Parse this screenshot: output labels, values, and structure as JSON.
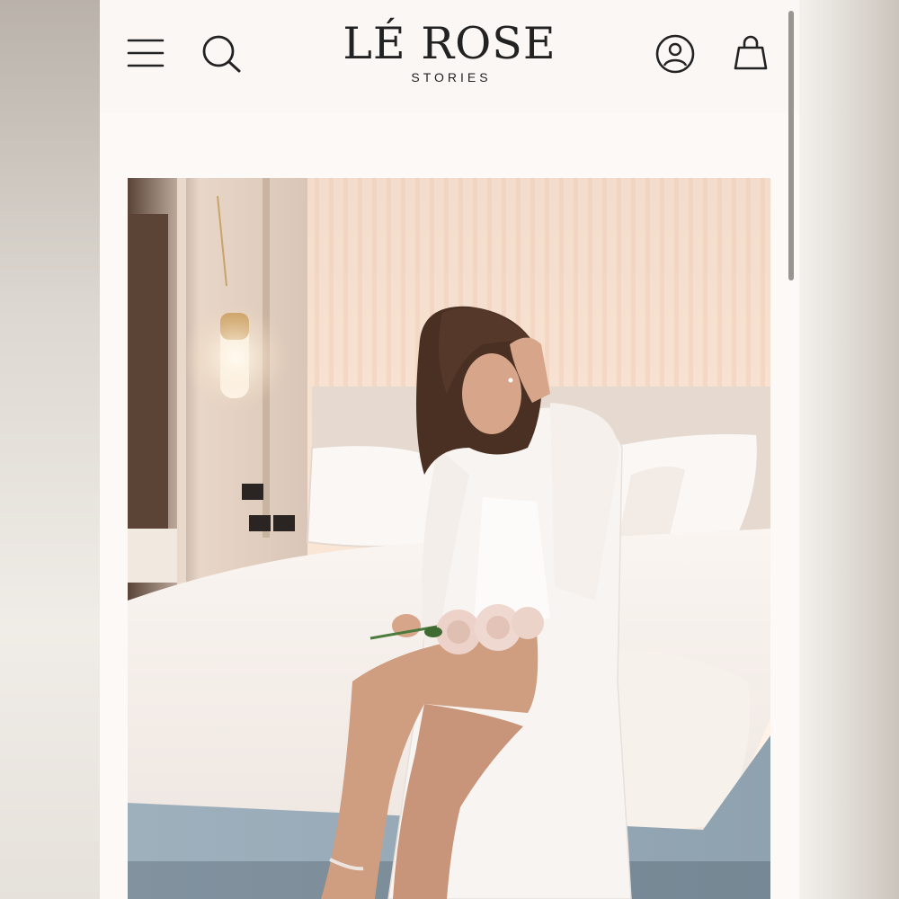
{
  "header": {
    "brand_name": "LÉ ROSE",
    "brand_tagline": "STORIES",
    "icons": {
      "menu": "hamburger-menu-icon",
      "search": "search-icon",
      "account": "user-account-icon",
      "cart": "shopping-bag-icon"
    }
  },
  "hero": {
    "image": "woman-in-white-robe-on-hotel-bed-with-roses"
  },
  "colors": {
    "header_background": "#fbf7f4",
    "page_background": "#fcf9f7",
    "icon_stroke": "#222222"
  }
}
